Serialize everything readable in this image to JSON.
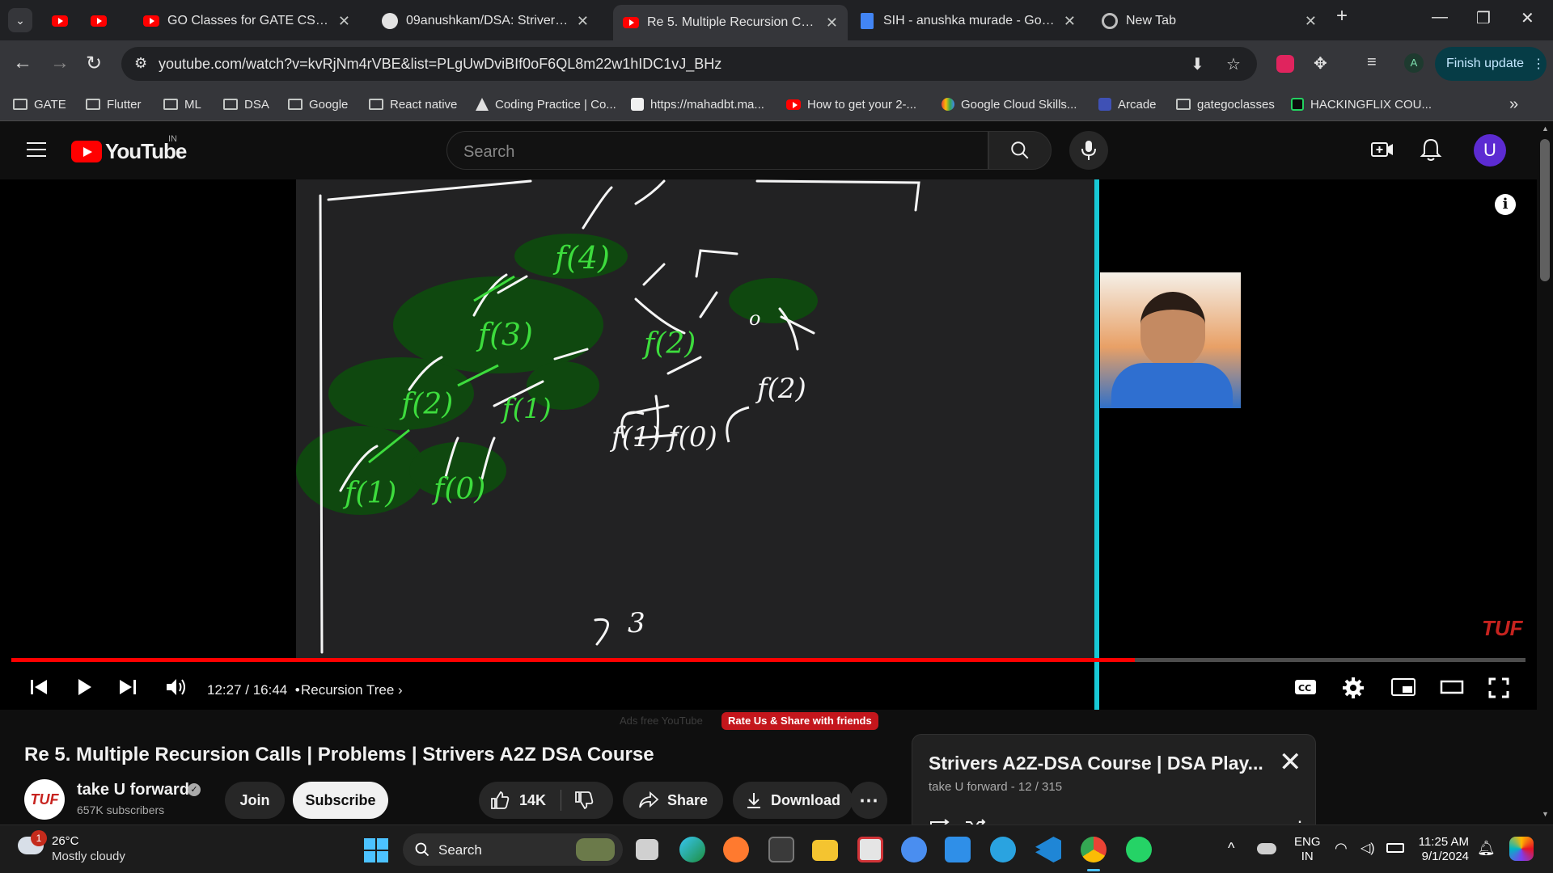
{
  "browser": {
    "tabs": [
      {
        "title": "",
        "icon": "youtube-icon"
      },
      {
        "title": "",
        "icon": "youtube-icon"
      },
      {
        "title": "GO Classes for GATE CS - YouTu",
        "icon": "youtube-icon"
      },
      {
        "title": "09anushkam/DSA: Striver's DSA",
        "icon": "github-icon"
      },
      {
        "title": "Re 5. Multiple Recursion Calls |",
        "icon": "youtube-icon",
        "active": true
      },
      {
        "title": "SIH - anushka murade - Google",
        "icon": "docs-icon"
      },
      {
        "title": "New Tab",
        "icon": "chrome-icon"
      }
    ],
    "url": "youtube.com/watch?v=kvRjNm4rVBE&list=PLgUwDviBIf0oF6QL8m22w1hIDC1vJ_BHz",
    "profile_letter": "A",
    "finish_update_label": "Finish update",
    "bookmarks": [
      {
        "label": "GATE",
        "icon": "folder-icon"
      },
      {
        "label": "Flutter",
        "icon": "folder-icon"
      },
      {
        "label": "ML",
        "icon": "folder-icon"
      },
      {
        "label": "DSA",
        "icon": "folder-icon"
      },
      {
        "label": "Google",
        "icon": "folder-icon"
      },
      {
        "label": "React native",
        "icon": "folder-icon"
      },
      {
        "label": "Coding Practice | Co...",
        "icon": "codingninjas-icon"
      },
      {
        "label": "https://mahadbt.ma...",
        "icon": "page-icon"
      },
      {
        "label": "How to get your 2-...",
        "icon": "youtube-icon"
      },
      {
        "label": "Google Cloud Skills...",
        "icon": "google-cloud-icon"
      },
      {
        "label": "Arcade",
        "icon": "arcade-icon"
      },
      {
        "label": "gategoclasses",
        "icon": "folder-icon"
      },
      {
        "label": "HACKINGFLIX COU...",
        "icon": "hackingflix-icon"
      }
    ]
  },
  "youtube": {
    "logo_text": "YouTube",
    "country_code": "IN",
    "search_placeholder": "Search",
    "avatar_letter": "U",
    "player": {
      "time": "12:27 / 16:44",
      "chapter": "Recursion Tree",
      "progress": 0.742,
      "watermark": "TUF"
    },
    "ads_text": "Ads free YouTube",
    "rate_chip": "Rate Us & Share with friends",
    "video_title": "Re 5. Multiple Recursion Calls | Problems | Strivers A2Z DSA Course",
    "channel": {
      "avatar_text": "TUF",
      "name": "take U forward",
      "subscribers": "657K subscribers"
    },
    "actions": {
      "join": "Join",
      "subscribe": "Subscribe",
      "likes": "14K",
      "share": "Share",
      "download": "Download"
    },
    "playlist": {
      "title": "Strivers A2Z-DSA Course | DSA Play...",
      "subtitle": "take U forward - 12 / 315"
    }
  },
  "taskbar": {
    "weather_badge": "1",
    "temperature": "26°C",
    "weather": "Mostly cloudy",
    "search_placeholder": "Search",
    "lang_1": "ENG",
    "lang_2": "IN",
    "time": "11:25 AM",
    "date": "9/1/2024"
  }
}
